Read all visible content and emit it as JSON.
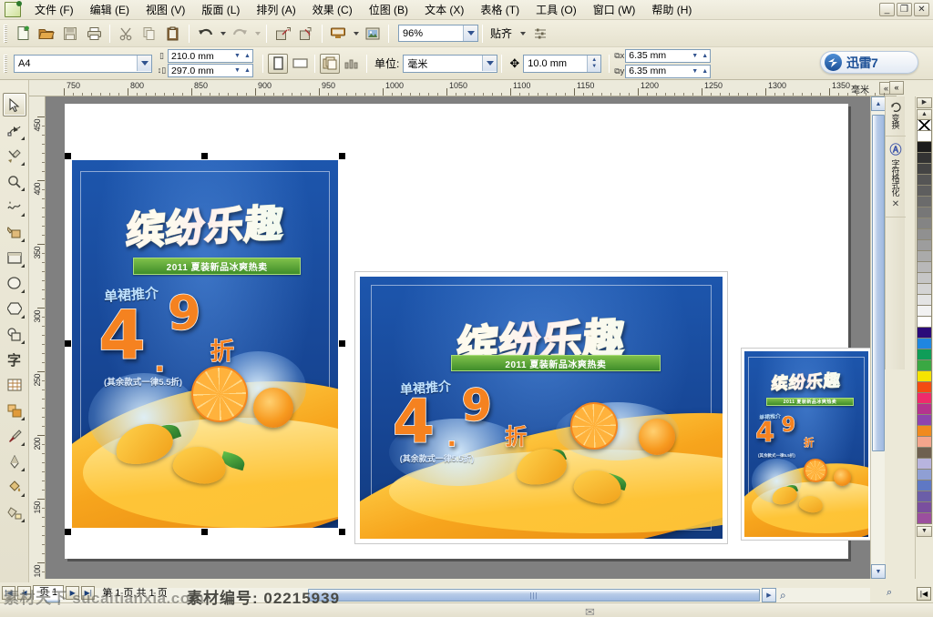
{
  "window": {
    "title": "CorelDRAW",
    "app_icon": "document-icon",
    "controls": {
      "minimize": "_",
      "restore": "❐",
      "close": "✕"
    }
  },
  "menubar": {
    "items": [
      {
        "label": "文件 (F)",
        "name": "menu-file"
      },
      {
        "label": "编辑 (E)",
        "name": "menu-edit"
      },
      {
        "label": "视图 (V)",
        "name": "menu-view"
      },
      {
        "label": "版面 (L)",
        "name": "menu-layout"
      },
      {
        "label": "排列 (A)",
        "name": "menu-arrange"
      },
      {
        "label": "效果 (C)",
        "name": "menu-effects"
      },
      {
        "label": "位图 (B)",
        "name": "menu-bitmaps"
      },
      {
        "label": "文本 (X)",
        "name": "menu-text"
      },
      {
        "label": "表格 (T)",
        "name": "menu-table"
      },
      {
        "label": "工具 (O)",
        "name": "menu-tools"
      },
      {
        "label": "窗口 (W)",
        "name": "menu-window"
      },
      {
        "label": "帮助 (H)",
        "name": "menu-help"
      }
    ]
  },
  "toolbar": {
    "buttons": [
      {
        "name": "new-document-button",
        "icon": "new-doc-icon"
      },
      {
        "name": "open-document-button",
        "icon": "folder-open-icon"
      },
      {
        "name": "save-document-button",
        "icon": "floppy-disk-icon"
      },
      {
        "name": "print-button",
        "icon": "printer-icon"
      },
      {
        "name": "cut-button",
        "icon": "scissors-icon"
      },
      {
        "name": "copy-button",
        "icon": "copy-icon"
      },
      {
        "name": "paste-button",
        "icon": "clipboard-paste-icon"
      },
      {
        "name": "undo-button",
        "icon": "undo-arrow-icon"
      },
      {
        "name": "redo-button",
        "icon": "redo-arrow-icon"
      },
      {
        "name": "import-button",
        "icon": "import-icon"
      },
      {
        "name": "export-button",
        "icon": "export-icon"
      },
      {
        "name": "application-launcher-button",
        "icon": "monitor-icon"
      },
      {
        "name": "corel-online-button",
        "icon": "picture-icon"
      },
      {
        "name": "options-button",
        "icon": "list-options-icon"
      }
    ],
    "zoom_level": "96%",
    "snap_label": "贴齐"
  },
  "propertybar": {
    "paper_type": "A4",
    "page_width": "210.0 mm",
    "page_height": "297.0 mm",
    "orientation_portrait": "portrait-icon",
    "orientation_landscape": "landscape-icon",
    "all_pages_icon": "all-pages-icon",
    "current_page_icon": "current-page-icon",
    "unit_label": "单位:",
    "unit_value": "毫米",
    "nudge_offset": "10.0 mm",
    "bleed_x": "6.35 mm",
    "bleed_y": "6.35 mm"
  },
  "xunlei": {
    "badge": "⤓",
    "label": "迅雷7"
  },
  "toolbox": {
    "tools": [
      {
        "name": "pick-tool",
        "icon": "arrow-cursor-icon",
        "active": true,
        "flyout": false
      },
      {
        "name": "shape-tool",
        "icon": "shape-node-icon",
        "active": false,
        "flyout": true
      },
      {
        "name": "crop-tool",
        "icon": "crop-knife-icon",
        "active": false,
        "flyout": true
      },
      {
        "name": "zoom-tool",
        "icon": "magnifier-icon",
        "active": false,
        "flyout": true
      },
      {
        "name": "freehand-tool",
        "icon": "freehand-curve-icon",
        "active": false,
        "flyout": true
      },
      {
        "name": "smart-fill-tool",
        "icon": "smart-fill-icon",
        "active": false,
        "flyout": true
      },
      {
        "name": "rectangle-tool",
        "icon": "rectangle-icon",
        "active": false,
        "flyout": true
      },
      {
        "name": "ellipse-tool",
        "icon": "ellipse-icon",
        "active": false,
        "flyout": true
      },
      {
        "name": "polygon-tool",
        "icon": "polygon-icon",
        "active": false,
        "flyout": true
      },
      {
        "name": "basic-shapes-tool",
        "icon": "basic-shapes-icon",
        "active": false,
        "flyout": true
      },
      {
        "name": "text-tool",
        "icon": "text-character-icon",
        "active": false,
        "flyout": false
      },
      {
        "name": "table-tool",
        "icon": "table-grid-icon",
        "active": false,
        "flyout": false
      },
      {
        "name": "blend-tool",
        "icon": "blend-squares-icon",
        "active": false,
        "flyout": true
      },
      {
        "name": "eyedropper-tool",
        "icon": "eyedropper-icon",
        "active": false,
        "flyout": true
      },
      {
        "name": "outline-tool",
        "icon": "outline-pen-icon",
        "active": false,
        "flyout": true
      },
      {
        "name": "fill-tool",
        "icon": "paint-bucket-icon",
        "active": false,
        "flyout": true
      },
      {
        "name": "interactive-fill-tool",
        "icon": "interactive-fill-icon",
        "active": false,
        "flyout": true
      }
    ]
  },
  "rulers": {
    "unit_tag": "毫米",
    "collapse_icon": "«",
    "horizontal_labels": [
      "750",
      "800",
      "850",
      "900",
      "950",
      "1000",
      "1050",
      "1100",
      "1150",
      "1200",
      "1250",
      "1300",
      "1350"
    ],
    "vertical_labels": [
      "450",
      "400",
      "350",
      "300",
      "250",
      "200",
      "150",
      "100"
    ]
  },
  "canvas": {
    "posters": [
      {
        "name": "poster-large-selected",
        "selected": true,
        "title": "缤纷乐趣",
        "banner": "2011 夏装新品冰爽热卖",
        "promo": "单裙推介",
        "discount_int": "4",
        "discount_dec": "9",
        "discount_unit": "折",
        "note": "(其余款式一律5.5折)"
      },
      {
        "name": "poster-medium",
        "selected": false,
        "title": "缤纷乐趣",
        "banner": "2011 夏装新品冰爽热卖",
        "promo": "单裙推介",
        "discount_int": "4",
        "discount_dec": "9",
        "discount_unit": "折",
        "note": "(其余款式一律5.5折)"
      },
      {
        "name": "poster-small",
        "selected": false,
        "title": "缤纷乐趣",
        "banner": "2011 夏装新品冰爽热卖",
        "promo": "单裙推介",
        "discount_int": "4",
        "discount_dec": "9",
        "discount_unit": "折",
        "note": "(其余款式一律5.5折)"
      }
    ]
  },
  "dockers": {
    "tabs": [
      {
        "name": "docker-transform",
        "label": "变换",
        "icon": "transform-rotate-icon"
      },
      {
        "name": "docker-character-format",
        "label": "字符格式化",
        "icon": "character-A-icon"
      }
    ],
    "close_icon": "✕",
    "collapse_icon": "«"
  },
  "palette": {
    "scroll_up_icon": "▲",
    "scroll_down_icon": "▼",
    "expand_icon": "▶",
    "colors": [
      "#ffffff",
      "#1c1c1c",
      "#333333",
      "#444444",
      "#555555",
      "#5e5e5e",
      "#6b6b6b",
      "#777777",
      "#848484",
      "#909090",
      "#9d9d9d",
      "#aaaaaa",
      "#b8b8b8",
      "#c6c6c6",
      "#d4d4d4",
      "#e4e4e4",
      "#f2f2f2",
      "#ffffff",
      "#2b0a7a",
      "#1f86e0",
      "#0f9d58",
      "#3aa843",
      "#f5e400",
      "#f44b12",
      "#ee2b6c",
      "#b5338e",
      "#8e44ad",
      "#f08a1e",
      "#f4a58c",
      "#6e6050",
      "#b8b4de",
      "#8f9fd4",
      "#5f78c4",
      "#6b5ea8",
      "#7a4f9e",
      "#9b4f9e"
    ]
  },
  "statusbar": {
    "prev_page_icon": "◀",
    "next_page_icon": "▶",
    "page_tab": "页 1",
    "page_text": "第 1 页,共 1 页",
    "watermark": "素材天下 sucaitianxia.com",
    "watermark_id": "素材编号: 02215939",
    "zoom_icon": "zoom-icon",
    "end_icon": "|◀"
  }
}
